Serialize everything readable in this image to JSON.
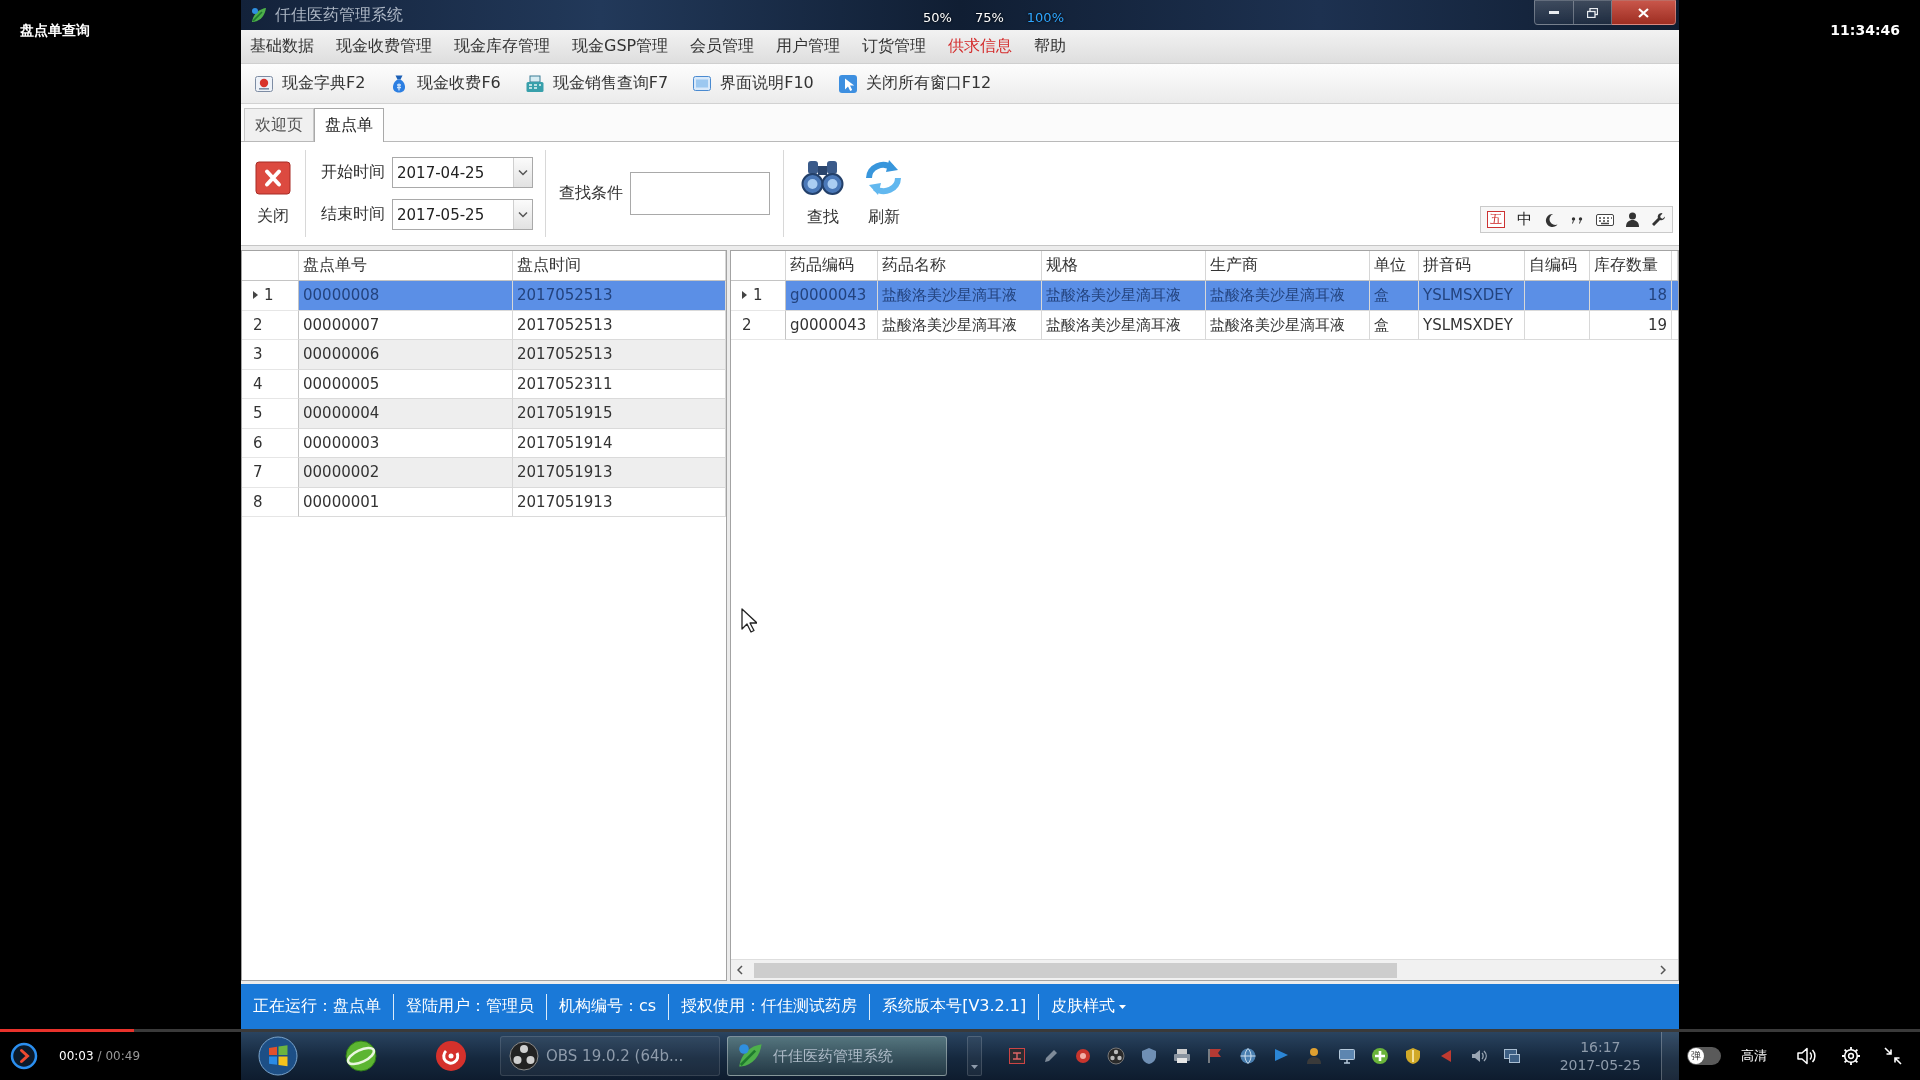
{
  "player": {
    "title": "盘点单查询",
    "clock": "11:34:46",
    "zoom_levels": [
      {
        "label": "50%",
        "selected": false
      },
      {
        "label": "75%",
        "selected": false
      },
      {
        "label": "100%",
        "selected": true
      }
    ]
  },
  "window": {
    "title": "仟佳医药管理系统"
  },
  "menu": [
    {
      "label": "基础数据",
      "highlighted": false
    },
    {
      "label": "现金收费管理",
      "highlighted": false
    },
    {
      "label": "现金库存管理",
      "highlighted": false
    },
    {
      "label": "现金GSP管理",
      "highlighted": false
    },
    {
      "label": "会员管理",
      "highlighted": false
    },
    {
      "label": "用户管理",
      "highlighted": false
    },
    {
      "label": "订货管理",
      "highlighted": false
    },
    {
      "label": "供求信息",
      "highlighted": true
    },
    {
      "label": "帮助",
      "highlighted": false
    }
  ],
  "toolbar": [
    {
      "label": "现金字典F2",
      "kind": "dictionary"
    },
    {
      "label": "现金收费F6",
      "kind": "charge"
    },
    {
      "label": "现金销售查询F7",
      "kind": "sales"
    },
    {
      "label": "界面说明F10",
      "kind": "guide"
    },
    {
      "label": "关闭所有窗口F12",
      "kind": "close-all"
    }
  ],
  "tabs": [
    {
      "label": "欢迎页",
      "selected": false
    },
    {
      "label": "盘点单",
      "selected": true
    }
  ],
  "filter": {
    "close_button": "关闭",
    "start_time": {
      "label": "开始时间",
      "value": "2017-04-25"
    },
    "end_time": {
      "label": "结束时间",
      "value": "2017-05-25"
    },
    "search": {
      "label": "查找条件"
    },
    "find_button": "查找",
    "refresh_button": "刷新"
  },
  "ime_bar": {
    "mode": "五",
    "language": "中"
  },
  "count_table": {
    "columns": [
      "盘点单号",
      "盘点时间"
    ],
    "rows": [
      {
        "index": "1",
        "selected": true,
        "cells": [
          "00000008",
          "2017052513"
        ]
      },
      {
        "index": "2",
        "selected": false,
        "cells": [
          "00000007",
          "2017052513"
        ]
      },
      {
        "index": "3",
        "selected": false,
        "cells": [
          "00000006",
          "2017052513"
        ]
      },
      {
        "index": "4",
        "selected": false,
        "cells": [
          "00000005",
          "2017052311"
        ]
      },
      {
        "index": "5",
        "selected": false,
        "cells": [
          "00000004",
          "2017051915"
        ]
      },
      {
        "index": "6",
        "selected": false,
        "cells": [
          "00000003",
          "2017051914"
        ]
      },
      {
        "index": "7",
        "selected": false,
        "cells": [
          "00000002",
          "2017051913"
        ]
      },
      {
        "index": "8",
        "selected": false,
        "cells": [
          "00000001",
          "2017051913"
        ]
      }
    ]
  },
  "detail_table": {
    "columns": [
      "药品编码",
      "药品名称",
      "规格",
      "生产商",
      "单位",
      "拼音码",
      "自编码",
      "库存数量"
    ],
    "rows": [
      {
        "index": "1",
        "selected": true,
        "cells": [
          "g0000043",
          "盐酸洛美沙星滴耳液",
          "盐酸洛美沙星滴耳液",
          "盐酸洛美沙星滴耳液",
          "盒",
          "YSLMSXDEY",
          null,
          "18"
        ]
      },
      {
        "index": "2",
        "selected": false,
        "cells": [
          "g0000043",
          "盐酸洛美沙星滴耳液",
          "盐酸洛美沙星滴耳液",
          "盐酸洛美沙星滴耳液",
          "盒",
          "YSLMSXDEY",
          null,
          "19"
        ]
      }
    ]
  },
  "status_bar": {
    "items": [
      "正在运行：盘点单",
      "登陆用户：管理员",
      "机构编号：cs",
      "授权使用：仟佳测试药房",
      "系统版本号[V3.2.1]"
    ],
    "skin_menu": "皮肤样式"
  },
  "taskbar": {
    "windows": [
      {
        "label": "OBS 19.0.2 (64b...",
        "kind": "recorder",
        "selected": false
      },
      {
        "label": "仟佳医药管理系统",
        "kind": "app",
        "selected": true
      }
    ],
    "time": "16:17",
    "date": "2017-05-25"
  },
  "playback": {
    "position": "00:03",
    "duration": "/ 00:49",
    "level": 0.07,
    "danmaku": {
      "label": "弹",
      "on": false
    },
    "quality": "高清"
  }
}
